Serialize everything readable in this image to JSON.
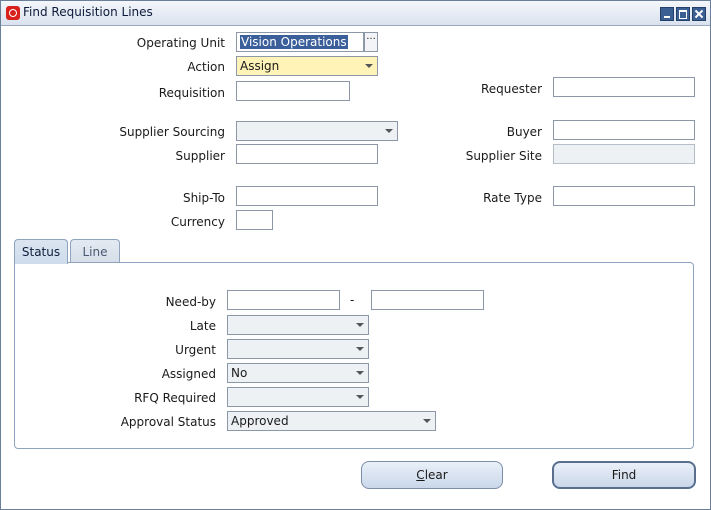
{
  "window": {
    "title": "Find Requisition Lines"
  },
  "fields": {
    "operating_unit": {
      "label": "Operating Unit",
      "value": "Vision Operations"
    },
    "action": {
      "label": "Action",
      "value": "Assign"
    },
    "requisition": {
      "label": "Requisition",
      "value": ""
    },
    "requester": {
      "label": "Requester",
      "value": ""
    },
    "supplier_sourcing": {
      "label": "Supplier Sourcing",
      "value": ""
    },
    "buyer": {
      "label": "Buyer",
      "value": ""
    },
    "supplier": {
      "label": "Supplier",
      "value": ""
    },
    "supplier_site": {
      "label": "Supplier Site",
      "value": ""
    },
    "ship_to": {
      "label": "Ship-To",
      "value": ""
    },
    "rate_type": {
      "label": "Rate Type",
      "value": ""
    },
    "currency": {
      "label": "Currency",
      "value": ""
    }
  },
  "tabs": [
    {
      "label": "Status",
      "active": true
    },
    {
      "label": "Line",
      "active": false
    }
  ],
  "status": {
    "need_by": {
      "label": "Need-by",
      "from": "",
      "to": "",
      "separator": "-"
    },
    "late": {
      "label": "Late",
      "value": ""
    },
    "urgent": {
      "label": "Urgent",
      "value": ""
    },
    "assigned": {
      "label": "Assigned",
      "value": "No"
    },
    "rfq_required": {
      "label": "RFQ Required",
      "value": ""
    },
    "approval_status": {
      "label": "Approval Status",
      "value": "Approved"
    }
  },
  "buttons": {
    "clear_mnemonic": "C",
    "clear_rest": "lear",
    "find": "Find"
  },
  "lov_glyph": "···"
}
